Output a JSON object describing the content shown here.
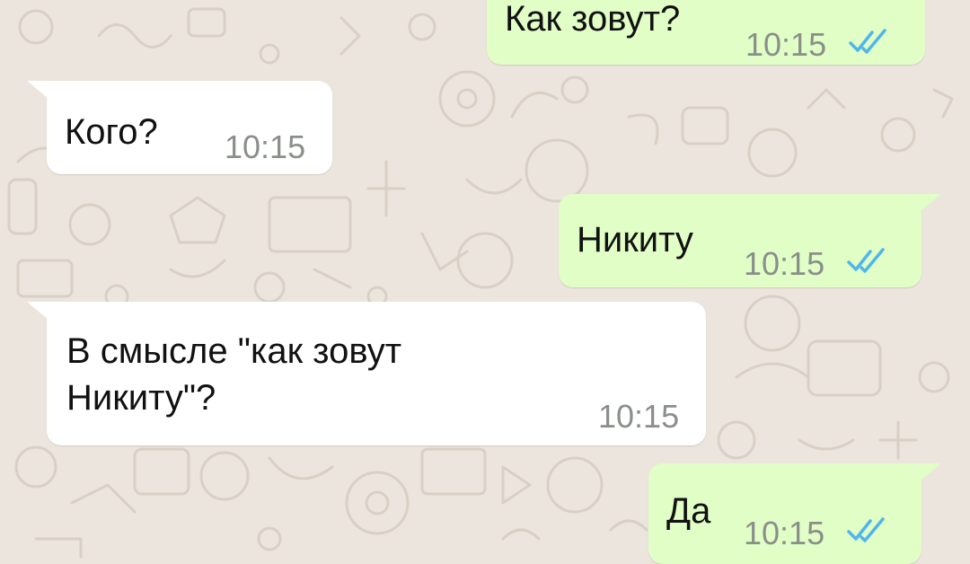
{
  "chat": {
    "messages": [
      {
        "direction": "outgoing",
        "text": "Как зовут?",
        "time": "10:15",
        "status_icon": "double-check-read-icon"
      },
      {
        "direction": "incoming",
        "text": "Кого?",
        "time": "10:15"
      },
      {
        "direction": "outgoing",
        "text": "Никиту",
        "time": "10:15",
        "status_icon": "double-check-read-icon"
      },
      {
        "direction": "incoming",
        "text_lines": [
          "В смысле \"как зовут",
          "Никиту\"?"
        ],
        "time": "10:15"
      },
      {
        "direction": "outgoing",
        "text": "Да",
        "time": "10:15",
        "status_icon": "double-check-read-icon"
      }
    ]
  },
  "colors": {
    "background": "#ece5dd",
    "outgoing_bubble": "#e1fec6",
    "incoming_bubble": "#ffffff",
    "read_ticks": "#4fb6ec",
    "time_text": "#8a8f8a"
  }
}
